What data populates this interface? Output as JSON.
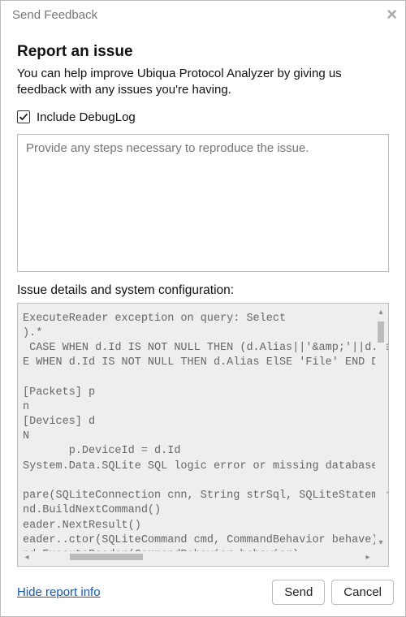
{
  "window": {
    "title": "Send Feedback"
  },
  "heading": "Report an issue",
  "description": "You can help improve Ubiqua Protocol Analyzer by giving us feedback with any issues you're having.",
  "include_debug": {
    "label": "Include DebugLog",
    "checked": true
  },
  "repro": {
    "placeholder": "Provide any steps necessary to reproduce the issue.",
    "value": ""
  },
  "details_label": "Issue details and system configuration:",
  "details_text": "ExecuteReader exception on query: Select\n).*\n CASE WHEN d.Id IS NOT NULL THEN (d.Alias||'&amp;'||d.De\nE WHEN d.Id IS NOT NULL THEN d.Alias ElSE 'File' END De\n\n[Packets] p\nn\n[Devices] d\nN\n       p.DeviceId = d.Id\nSystem.Data.SQLite SQL logic error or missing database\n\npare(SQLiteConnection cnn, String strSql, SQLiteStatemen\nnd.BuildNextCommand()\neader.NextResult()\neader..ctor(SQLiteCommand cmd, CommandBehavior behave)\nnd.ExecuteReader(CommandBehavior behavior)",
  "footer": {
    "hide_link": "Hide report info",
    "send": "Send",
    "cancel": "Cancel"
  }
}
